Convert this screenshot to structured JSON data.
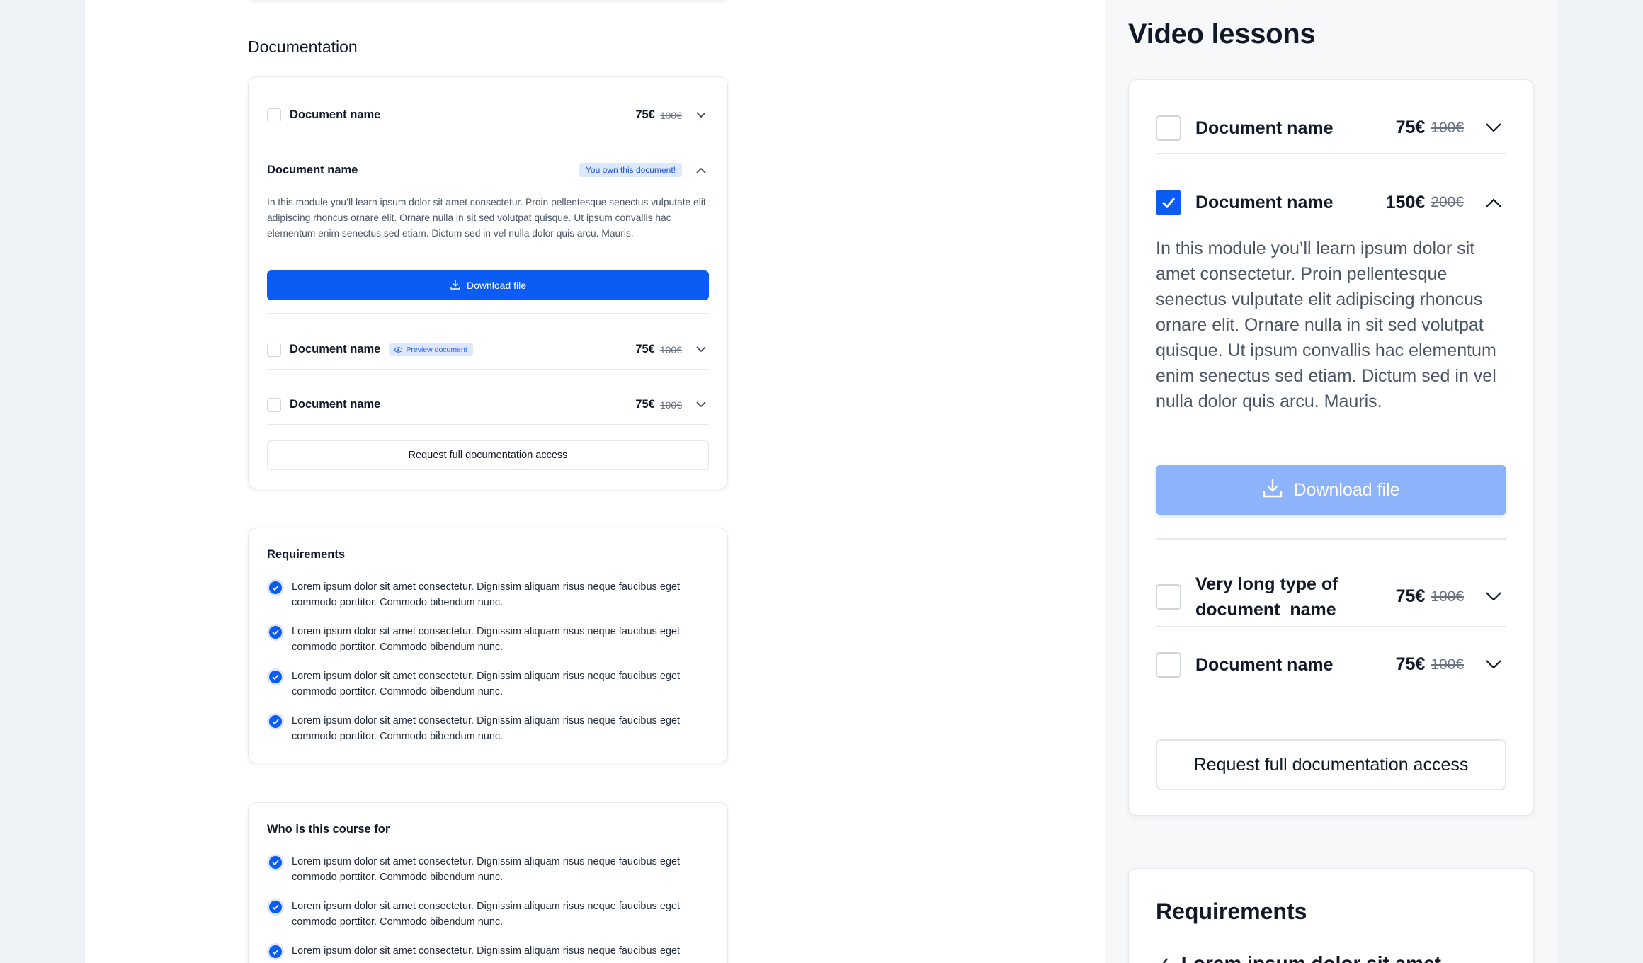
{
  "documentation": {
    "heading": "Documentation",
    "items": [
      {
        "name": "Document name",
        "price": "75€",
        "old_price": "100€"
      },
      {
        "name": "Document name",
        "badge": "You own this document!",
        "description": "In this module you’ll learn ipsum dolor sit amet consectetur. Proin pellentesque senectus vulputate elit adipiscing rhoncus ornare elit. Ornare nulla in sit sed volutpat quisque. Ut ipsum convallis hac elementum enim senectus sed etiam. Dictum sed in vel nulla dolor quis arcu. Mauris.",
        "download_label": "Download file"
      },
      {
        "name": "Document name",
        "badge": "Preview document",
        "price": "75€",
        "old_price": "100€"
      },
      {
        "name": "Document name",
        "price": "75€",
        "old_price": "100€"
      }
    ],
    "request_label": "Request full documentation access"
  },
  "requirements": {
    "title": "Requirements",
    "items": [
      "Lorem ipsum dolor sit amet consectetur. Dignissim aliquam risus neque faucibus eget commodo porttitor. Commodo bibendum nunc.",
      "Lorem ipsum dolor sit amet consectetur. Dignissim aliquam risus neque faucibus eget commodo porttitor. Commodo bibendum nunc.",
      "Lorem ipsum dolor sit amet consectetur. Dignissim aliquam risus neque faucibus eget commodo porttitor. Commodo bibendum nunc.",
      "Lorem ipsum dolor sit amet consectetur. Dignissim aliquam risus neque faucibus eget commodo porttitor. Commodo bibendum nunc."
    ]
  },
  "audience": {
    "title": "Who is this course for",
    "items": [
      "Lorem ipsum dolor sit amet consectetur. Dignissim aliquam risus neque faucibus eget commodo porttitor. Commodo bibendum nunc.",
      "Lorem ipsum dolor sit amet consectetur. Dignissim aliquam risus neque faucibus eget commodo porttitor. Commodo bibendum nunc.",
      "Lorem ipsum dolor sit amet consectetur. Dignissim aliquam risus neque faucibus eget"
    ]
  },
  "video_lessons": {
    "title": "Video lessons",
    "items": [
      {
        "name": "Document name",
        "price": "75€",
        "old_price": "100€",
        "checked": false
      },
      {
        "name": "Document name",
        "price": "150€",
        "old_price": "200€",
        "checked": true,
        "description": "In this module you’ll learn ipsum dolor sit amet consectetur. Proin pellentesque senectus vulputate elit adipiscing rhoncus ornare elit. Ornare nulla in sit sed volutpat quisque. Ut ipsum convallis hac elementum enim senectus sed etiam. Dictum sed in vel nulla dolor quis arcu. Mauris.",
        "download_label": "Download file"
      },
      {
        "name_line1": "Very long type of",
        "name_line2": "document  name",
        "price": "75€",
        "old_price": "100€",
        "checked": false
      },
      {
        "name": "Document name",
        "price": "75€",
        "old_price": "100€",
        "checked": false
      }
    ],
    "request_label": "Request full documentation access"
  },
  "sidebar_requirements": {
    "title": "Requirements",
    "first_item_partial": "Lorem ipsum dolor sit amet"
  },
  "colors": {
    "primary": "#0a5cf5",
    "primary_disabled": "#8db4fa",
    "badge_bg": "#dbe8ff"
  }
}
